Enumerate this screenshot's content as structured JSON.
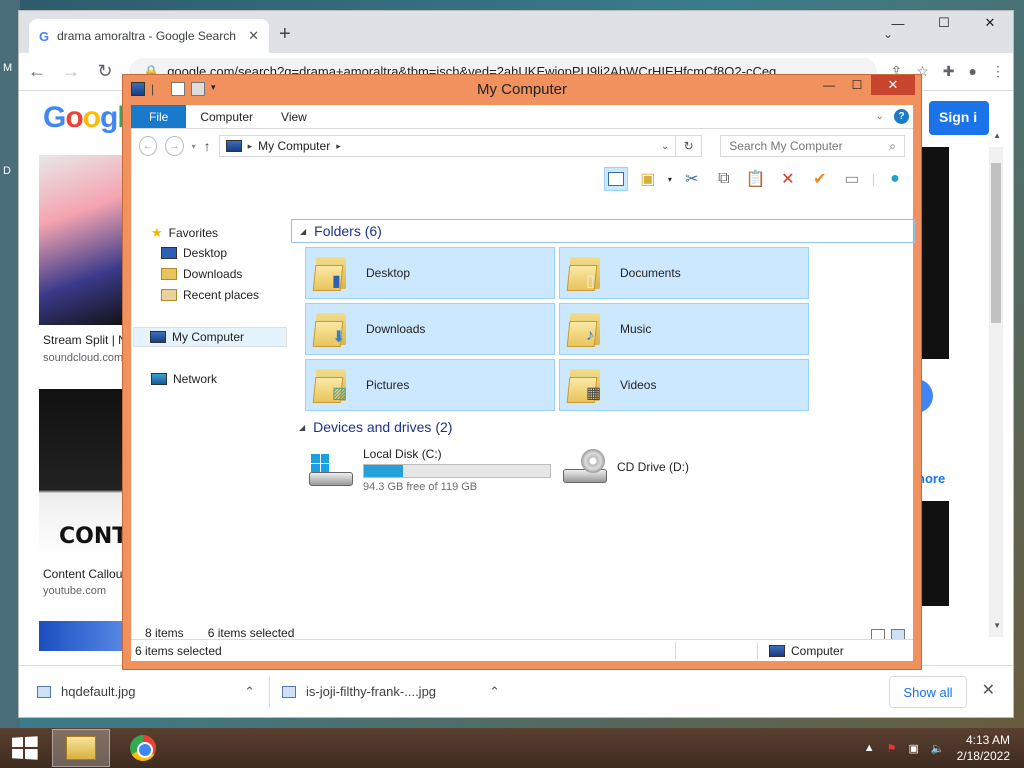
{
  "desktop": {
    "left_labels": [
      "M",
      "D"
    ]
  },
  "chrome": {
    "tab_title": "drama amoraltra - Google Search",
    "new_tab": "+",
    "url": "google.com/search?q=drama+amoraltra&tbm=isch&ved=2ahUKEwiopPU9li2AhWCrHIEHfcmCf8Q2-cCeg",
    "nav": {
      "back": "←",
      "forward": "→",
      "reload": "↻"
    },
    "window_controls": {
      "minimize": "—",
      "maximize": "☐",
      "close": "✕"
    },
    "page": {
      "signin": "Sign i",
      "results": [
        {
          "caption": "Stream Split | N",
          "source": "soundcloud.com"
        },
        {
          "caption": "Content Callou",
          "source": "youtube.com"
        }
      ],
      "thumb_text": "CONT",
      "right_more": "nore"
    },
    "downloads": [
      {
        "name": "hqdefault.jpg"
      },
      {
        "name": "is-joji-filthy-frank-....jpg"
      }
    ],
    "show_all": "Show all"
  },
  "explorer": {
    "title": "My Computer",
    "ribbon_tabs": [
      "File",
      "Computer",
      "View"
    ],
    "address": "My Computer",
    "search_placeholder": "Search My Computer",
    "nav": {
      "favorites": "Favorites",
      "desktop": "Desktop",
      "downloads": "Downloads",
      "recent": "Recent places",
      "my_computer": "My Computer",
      "network": "Network"
    },
    "folders_group": "Folders (6)",
    "folders": [
      "Desktop",
      "Documents",
      "Downloads",
      "Music",
      "Pictures",
      "Videos"
    ],
    "devices_group": "Devices and drives (2)",
    "drives": [
      {
        "name": "Local Disk (C:)",
        "free": "94.3 GB free of 119 GB",
        "used_fraction": 0.21
      },
      {
        "name": "CD Drive (D:)"
      }
    ],
    "status": {
      "items": "8 items",
      "selected": "6 items selected",
      "bottom_selected": "6 items selected",
      "bottom_location": "Computer"
    }
  },
  "taskbar": {
    "time": "4:13 AM",
    "date": "2/18/2022"
  },
  "colors": {
    "explorer_frame": "#f0915e",
    "ribbon_file": "#1979ca",
    "selection": "#cce8ff",
    "close_red": "#c7452f"
  }
}
